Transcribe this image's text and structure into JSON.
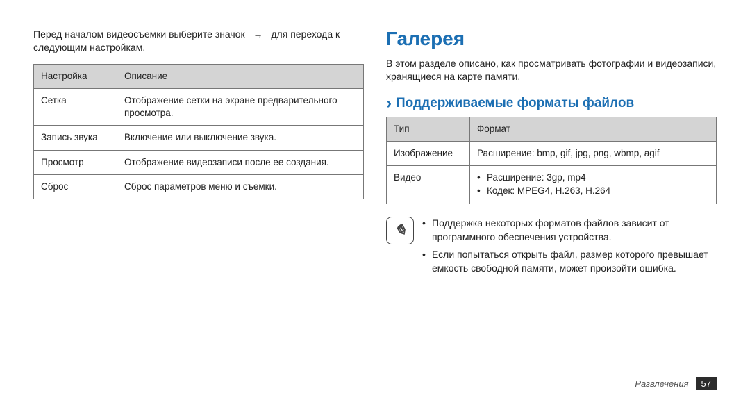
{
  "left": {
    "intro_1": "Перед началом видеосъемки выберите значок",
    "intro_arrow": "→",
    "intro_2": "для перехода к следующим настройкам.",
    "table": {
      "headers": {
        "setting": "Настройка",
        "desc": "Описание"
      },
      "rows": [
        {
          "setting": "Сетка",
          "desc": "Отображение сетки на экране предварительного просмотра."
        },
        {
          "setting": "Запись звука",
          "desc": "Включение или выключение звука."
        },
        {
          "setting": "Просмотр",
          "desc": "Отображение видеозаписи после ее создания."
        },
        {
          "setting": "Сброс",
          "desc": "Сброс параметров меню и съемки."
        }
      ]
    }
  },
  "right": {
    "h1": "Галерея",
    "desc": "В этом разделе описано, как просматривать фотографии и видеозаписи, хранящиеся на карте памяти.",
    "h2": "Поддерживаемые форматы файлов",
    "table": {
      "headers": {
        "type": "Тип",
        "format": "Формат"
      },
      "rows": {
        "image": {
          "type": "Изображение",
          "format": "Расширение: bmp, gif, jpg, png, wbmp, agif"
        },
        "video": {
          "type": "Видео",
          "bullets": [
            "Расширение: 3gp, mp4",
            "Кодек: MPEG4, H.263, H.264"
          ]
        }
      }
    },
    "notes": [
      "Поддержка некоторых форматов файлов зависит от программного обеспечения устройства.",
      "Если попытаться открыть файл, размер которого превышает емкость свободной памяти, может произойти ошибка."
    ]
  },
  "footer": {
    "category": "Развлечения",
    "page": "57"
  }
}
